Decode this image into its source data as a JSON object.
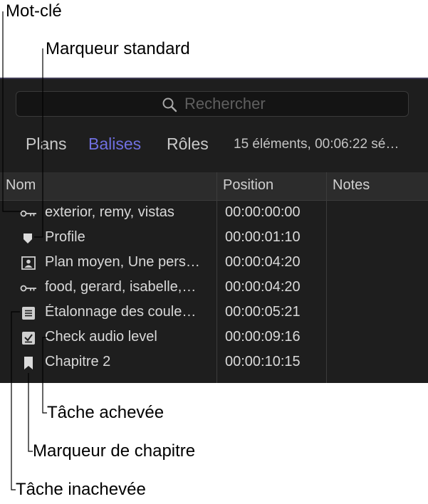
{
  "callouts": {
    "keyword": "Mot-clé",
    "standard_marker": "Marqueur standard",
    "completed_task": "Tâche achevée",
    "chapter_marker": "Marqueur de chapitre",
    "incomplete_task": "Tâche inachevée"
  },
  "search": {
    "placeholder": "Rechercher",
    "icon": "magnifier-icon"
  },
  "tabs": [
    {
      "label": "Plans",
      "active": false
    },
    {
      "label": "Balises",
      "active": true
    },
    {
      "label": "Rôles",
      "active": false
    }
  ],
  "summary": "15 éléments, 00:06:22 sé…",
  "table": {
    "columns": [
      "Nom",
      "Position",
      "Notes"
    ],
    "rows": [
      {
        "icon": "keyword-icon",
        "name": "exterior, remy, vistas",
        "position": "00:00:00:00"
      },
      {
        "icon": "standard-marker-icon",
        "name": "Profile",
        "position": "00:00:01:10"
      },
      {
        "icon": "person-frame-icon",
        "name": "Plan moyen, Une pers…",
        "position": "00:00:04:20"
      },
      {
        "icon": "keyword-icon",
        "name": "food, gerard, isabelle,…",
        "position": "00:00:04:20"
      },
      {
        "icon": "incomplete-task-icon",
        "name": "Étalonnage des coule…",
        "position": "00:00:05:21"
      },
      {
        "icon": "completed-task-icon",
        "name": "Check audio level",
        "position": "00:00:09:16"
      },
      {
        "icon": "chapter-marker-icon",
        "name": "Chapitre 2",
        "position": "00:00:10:15"
      }
    ]
  },
  "colors": {
    "panel_bg": "#1e1e1e",
    "active_tab": "#6f6fe0",
    "text": "#d9d9d9",
    "callout_line": "#000000"
  }
}
